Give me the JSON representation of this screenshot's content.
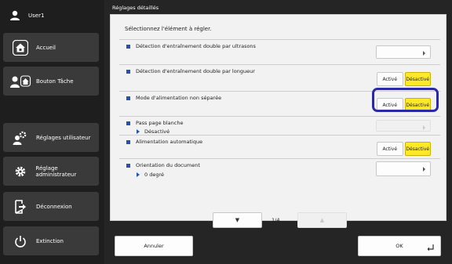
{
  "user": {
    "name": "User1",
    "icon": "user-icon"
  },
  "sidebar": {
    "items": [
      {
        "label": "Accueil",
        "icon": "home-icon"
      },
      {
        "label": "Bouton Tâche",
        "icon": "user-task-icon"
      },
      {
        "label": "Réglages utilisateur",
        "icon": "gear-user-icon"
      },
      {
        "label": "Réglage administrateur",
        "icon": "gear-icon"
      },
      {
        "label": "Déconnexion",
        "icon": "logout-icon"
      },
      {
        "label": "Extinction",
        "icon": "power-icon"
      }
    ]
  },
  "header": {
    "title": "Réglages détaillés"
  },
  "panel": {
    "instruction": "Sélectionnez l'élément à régler.",
    "settings": [
      {
        "label": "Détection d'entraînement double par ultrasons",
        "control": "arrow"
      },
      {
        "label": "Détection d'entraînement double par longueur",
        "control": "toggle",
        "on_label": "Activé",
        "off_label": "Désactivé",
        "selected": "off"
      },
      {
        "label": "Mode d'alimentation non séparée",
        "control": "toggle",
        "on_label": "Activé",
        "off_label": "Désactivé",
        "selected": "off"
      },
      {
        "label": "Pass page blanche",
        "value": "Désactivé",
        "control": "arrow-disabled"
      },
      {
        "label": "Alimentation automatique",
        "control": "toggle",
        "on_label": "Activé",
        "off_label": "Désactivé",
        "selected": "off"
      },
      {
        "label": "Orientation du document",
        "value": "0 degré",
        "control": "arrow"
      }
    ],
    "pager": {
      "down": "▼",
      "up": "▲",
      "page": "1/4"
    }
  },
  "footer": {
    "cancel_label": "Annuler",
    "ok_label": "OK"
  },
  "colors": {
    "accent": "#2352b5",
    "selected": "#fde928",
    "highlight": "#2a2aa6",
    "sidebar_bg": "#1e1e1e"
  }
}
